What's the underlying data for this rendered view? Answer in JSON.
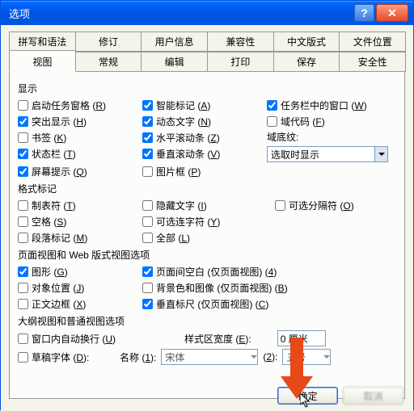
{
  "window": {
    "title": "选项"
  },
  "tabs_row1": [
    "拼写和语法",
    "修订",
    "用户信息",
    "兼容性",
    "中文版式",
    "文件位置"
  ],
  "tabs_row2": [
    "视图",
    "常规",
    "编辑",
    "打印",
    "保存",
    "安全性"
  ],
  "active_tab": "视图",
  "display": {
    "heading": "显示",
    "col1": [
      {
        "label": "启动任务窗格",
        "accel": "R",
        "checked": false
      },
      {
        "label": "突出显示",
        "accel": "H",
        "checked": true
      },
      {
        "label": "书签",
        "accel": "K",
        "checked": false
      },
      {
        "label": "状态栏",
        "accel": "T",
        "checked": true
      },
      {
        "label": "屏幕提示",
        "accel": "Q",
        "checked": true
      }
    ],
    "col2": [
      {
        "label": "智能标记",
        "accel": "A",
        "checked": true
      },
      {
        "label": "动态文字",
        "accel": "N",
        "checked": true
      },
      {
        "label": "水平滚动条",
        "accel": "Z",
        "checked": true
      },
      {
        "label": "垂直滚动条",
        "accel": "V",
        "checked": true
      },
      {
        "label": "图片框",
        "accel": "P",
        "checked": false
      }
    ],
    "col3": [
      {
        "label": "任务栏中的窗口",
        "accel": "W",
        "checked": true
      },
      {
        "label": "域代码",
        "accel": "F",
        "checked": false
      }
    ],
    "field_shading_label": "域底纹:",
    "field_shading_value": "选取时显示"
  },
  "marks": {
    "heading": "格式标记",
    "col1": [
      {
        "label": "制表符",
        "accel": "T",
        "checked": false
      },
      {
        "label": "空格",
        "accel": "S",
        "checked": false
      },
      {
        "label": "段落标记",
        "accel": "M",
        "checked": false
      }
    ],
    "col2": [
      {
        "label": "隐藏文字",
        "accel": "I",
        "checked": false
      },
      {
        "label": "可选连字符",
        "accel": "Y",
        "checked": false
      },
      {
        "label": "全部",
        "accel": "L",
        "checked": false
      }
    ],
    "col3": [
      {
        "label": "可选分隔符",
        "accel": "O",
        "checked": false
      }
    ]
  },
  "pageweb": {
    "heading": "页面视图和 Web 版式视图选项",
    "col1": [
      {
        "label": "图形",
        "accel": "G",
        "checked": true
      },
      {
        "label": "对象位置",
        "accel": "J",
        "checked": false
      },
      {
        "label": "正文边框",
        "accel": "X",
        "checked": false
      }
    ],
    "col2": [
      {
        "label": "页面间空白 (仅页面视图)",
        "accel": "4",
        "checked": true
      },
      {
        "label": "背景色和图像 (仅页面视图)",
        "accel": "B",
        "checked": false
      },
      {
        "label": "垂直标尺 (仅页面视图)",
        "accel": "C",
        "checked": true
      }
    ]
  },
  "outline": {
    "heading": "大纲视图和普通视图选项",
    "wrap": {
      "label": "窗口内自动换行",
      "accel": "U",
      "checked": false
    },
    "draft": {
      "label": "草稿字体",
      "accel": "D",
      "checked": false
    },
    "style_width_label": "样式区宽度",
    "style_width_accel": "E",
    "style_width_value": "0 厘米",
    "name_label": "名称",
    "name_accel": "1",
    "name_value": "宋体",
    "size_accel": "2",
    "size_value": "五号"
  },
  "buttons": {
    "ok": "确定",
    "cancel": "取消"
  }
}
